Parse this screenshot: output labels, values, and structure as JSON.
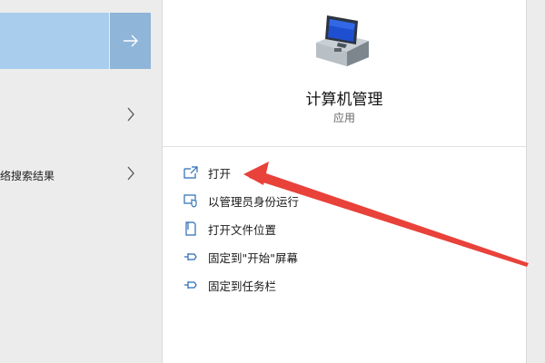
{
  "left_pane": {
    "web_search_text": "络搜索结果"
  },
  "app": {
    "name": "计算机管理",
    "type": "应用"
  },
  "actions": [
    {
      "label": "打开",
      "icon": "open-icon"
    },
    {
      "label": "以管理员身份运行",
      "icon": "run-as-admin-icon"
    },
    {
      "label": "打开文件位置",
      "icon": "file-location-icon"
    },
    {
      "label": "固定到\"开始\"屏幕",
      "icon": "pin-icon"
    },
    {
      "label": "固定到任务栏",
      "icon": "pin-icon"
    }
  ],
  "colors": {
    "selected_bg": "#a9cdec",
    "arrow_bg": "#8fb5d8",
    "icon_blue": "#2b6cb8",
    "annotation_red": "#e8423a"
  }
}
